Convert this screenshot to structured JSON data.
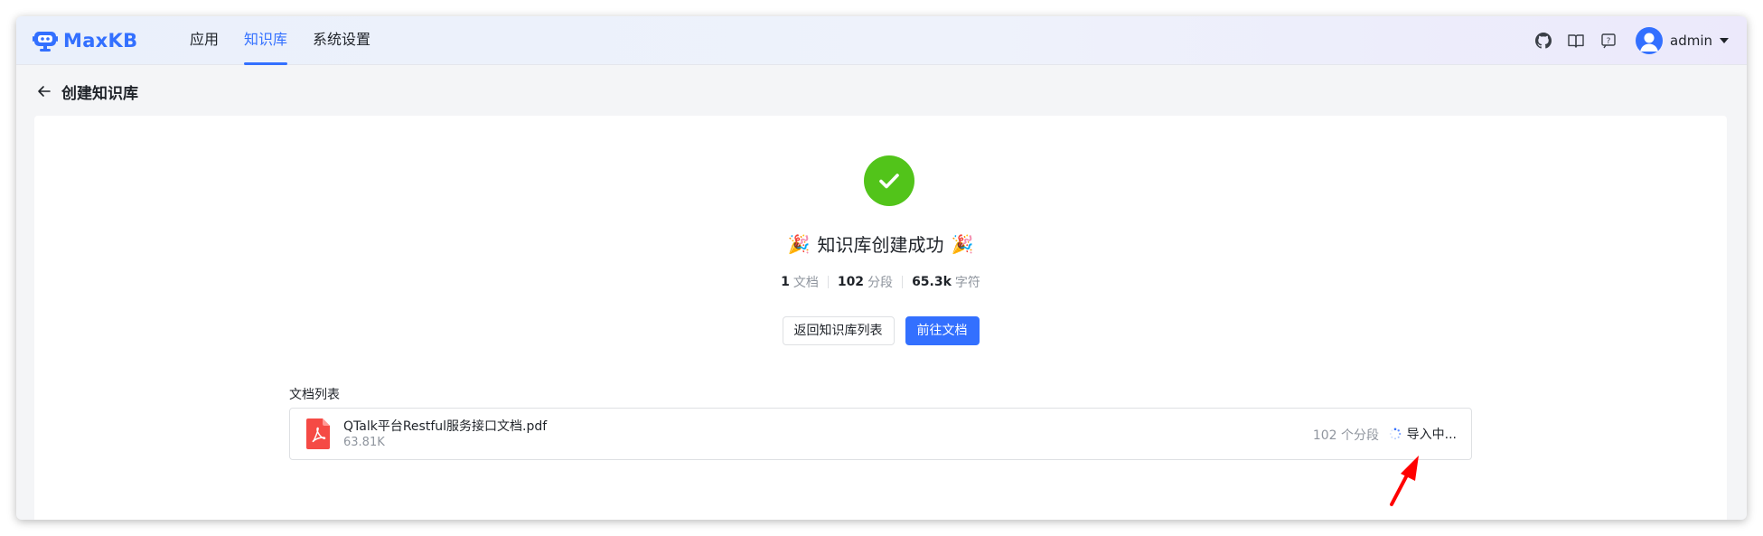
{
  "app": {
    "brand": "MaxKB",
    "nav": [
      {
        "label": "应用",
        "active": false
      },
      {
        "label": "知识库",
        "active": true
      },
      {
        "label": "系统设置",
        "active": false
      }
    ],
    "user": "admin",
    "header_icons": [
      "github-icon",
      "book-icon",
      "help-icon"
    ],
    "accent_color": "#3370ff"
  },
  "page": {
    "title": "创建知识库"
  },
  "result": {
    "title": "知识库创建成功",
    "stats": [
      {
        "value": "1",
        "unit": "文档"
      },
      {
        "value": "102",
        "unit": "分段"
      },
      {
        "value": "65.3k",
        "unit": "字符"
      }
    ],
    "back_button": "返回知识库列表",
    "go_button": "前往文档"
  },
  "documents": {
    "label": "文档列表",
    "items": [
      {
        "name": "QTalk平台Restful服务接口文档.pdf",
        "size": "63.81K",
        "segments": "102 个分段",
        "status": "导入中..."
      }
    ]
  },
  "colors": {
    "success": "#52c41a",
    "pdf": "#f54a45",
    "annotation_arrow": "#ff0000"
  }
}
